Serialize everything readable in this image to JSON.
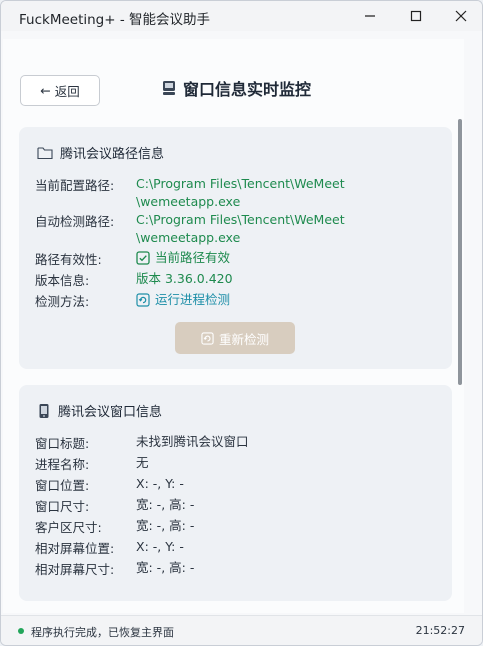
{
  "window": {
    "title": "FuckMeeting+ - 智能会议助手",
    "controls": {
      "minimize": "—",
      "maximize": "☐",
      "close": "✕"
    }
  },
  "header": {
    "back_label": "返回",
    "back_arrow": "←",
    "page_title": "窗口信息实时监控"
  },
  "path_card": {
    "title": "腾讯会议路径信息",
    "rows": {
      "current_config": {
        "label": "当前配置路径:",
        "value_line1": "C:\\Program Files\\Tencent\\WeMeet",
        "value_line2": "\\wemeetapp.exe"
      },
      "auto_detect": {
        "label": "自动检测路径:",
        "value_line1": "C:\\Program Files\\Tencent\\WeMeet",
        "value_line2": "\\wemeetapp.exe"
      },
      "validity": {
        "label": "路径有效性:",
        "value": "当前路径有效"
      },
      "version": {
        "label": "版本信息:",
        "value": "版本 3.36.0.420"
      },
      "method": {
        "label": "检测方法:",
        "value": "运行进程检测"
      }
    },
    "redetect_label": "重新检测"
  },
  "window_card": {
    "title": "腾讯会议窗口信息",
    "rows": [
      {
        "label": "窗口标题:",
        "value": "未找到腾讯会议窗口"
      },
      {
        "label": "进程名称:",
        "value": "无"
      },
      {
        "label": "窗口位置:",
        "value": "X: -, Y: -"
      },
      {
        "label": "窗口尺寸:",
        "value": "宽: -, 高: -"
      },
      {
        "label": "客户区尺寸:",
        "value": "宽: -, 高: -"
      },
      {
        "label": "相对屏幕位置:",
        "value": "X: -, Y: -"
      },
      {
        "label": "相对屏幕尺寸:",
        "value": "宽: -, 高: -"
      }
    ]
  },
  "status": {
    "text": "程序执行完成，已恢复主界面",
    "time": "21:52:27"
  },
  "colors": {
    "accent_green": "#1e8a4e",
    "accent_teal": "#1e8fa8",
    "status_dot": "#22a55a",
    "disabled_button": "#d8cdbf"
  }
}
